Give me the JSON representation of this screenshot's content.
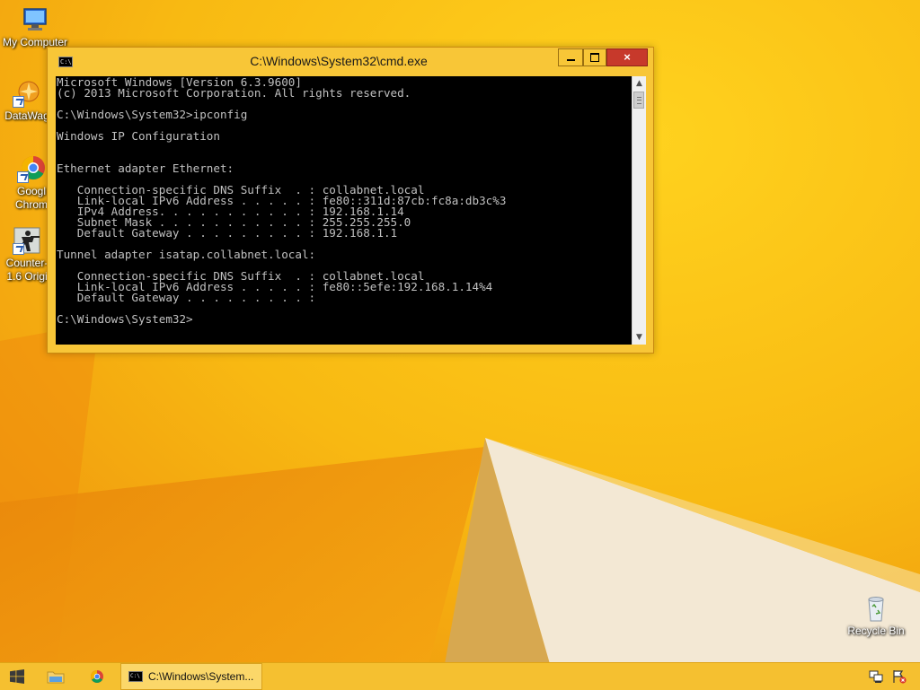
{
  "desktop": {
    "icons": [
      {
        "label": "My Computer",
        "icon": "computer-icon"
      },
      {
        "label": "DataWag",
        "icon": "datawag-icon"
      },
      {
        "label": "Googl",
        "label2": "Chrom",
        "icon": "chrome-icon"
      },
      {
        "label": "Counter-",
        "label2": "1.6 Origi",
        "icon": "counter-strike-icon"
      },
      {
        "label": "Recycle Bin",
        "icon": "recycle-bin-icon"
      }
    ]
  },
  "window": {
    "title": "C:\\Windows\\System32\\cmd.exe",
    "icon_text": "C:\\",
    "close_glyph": "×",
    "console_lines": [
      "Microsoft Windows [Version 6.3.9600]",
      "(c) 2013 Microsoft Corporation. All rights reserved.",
      "",
      "C:\\Windows\\System32>ipconfig",
      "",
      "Windows IP Configuration",
      "",
      "",
      "Ethernet adapter Ethernet:",
      "",
      "   Connection-specific DNS Suffix  . : collabnet.local",
      "   Link-local IPv6 Address . . . . . : fe80::311d:87cb:fc8a:db3c%3",
      "   IPv4 Address. . . . . . . . . . . : 192.168.1.14",
      "   Subnet Mask . . . . . . . . . . . : 255.255.255.0",
      "   Default Gateway . . . . . . . . . : 192.168.1.1",
      "",
      "Tunnel adapter isatap.collabnet.local:",
      "",
      "   Connection-specific DNS Suffix  . : collabnet.local",
      "   Link-local IPv6 Address . . . . . : fe80::5efe:192.168.1.14%4",
      "   Default Gateway . . . . . . . . . :",
      "",
      "C:\\Windows\\System32>"
    ]
  },
  "taskbar": {
    "cmd_label": "C:\\Windows\\System...",
    "cmd_icon_text": "C:\\"
  },
  "colors": {
    "wallpaper": "#f6b412",
    "console_bg": "#000000",
    "console_fg": "#c0c0c0",
    "close_button": "#c7392b"
  }
}
